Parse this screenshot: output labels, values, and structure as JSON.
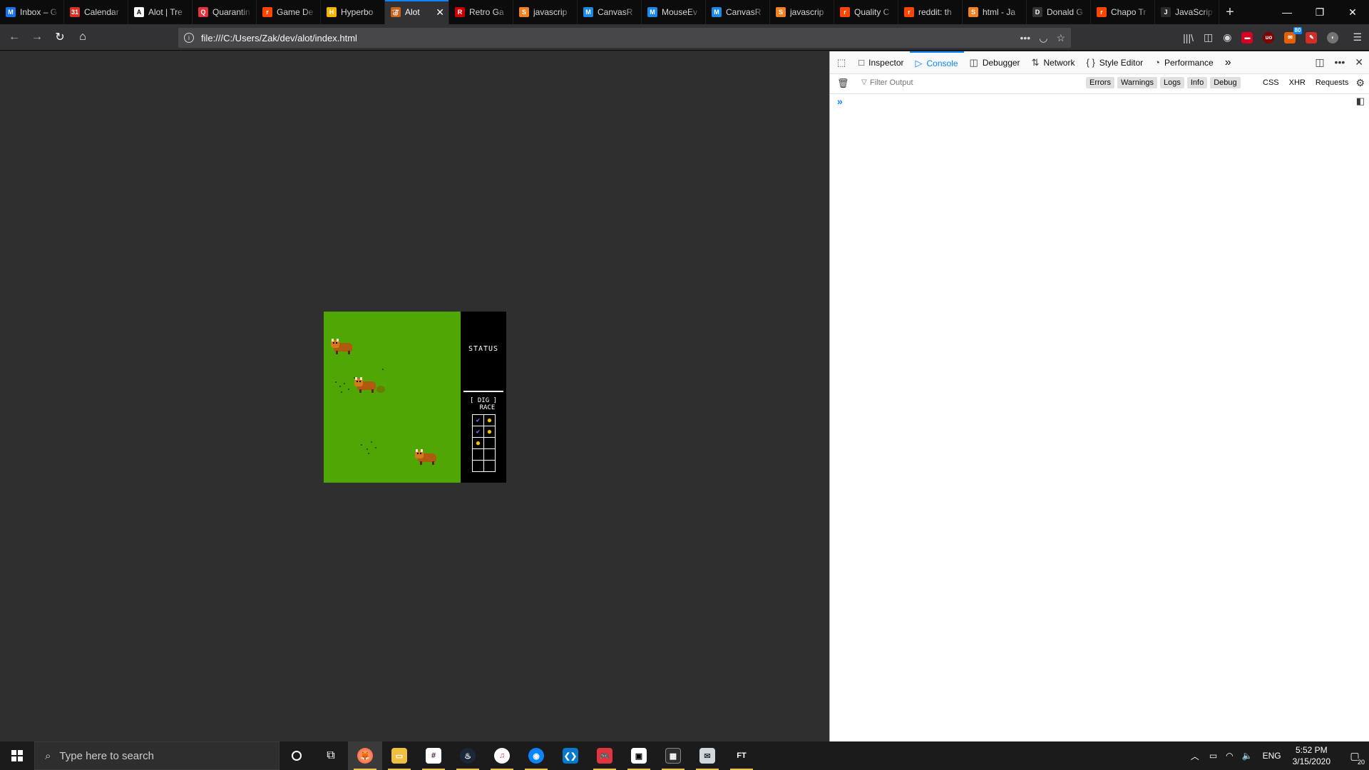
{
  "browser": {
    "tabs": [
      {
        "title": "Inbox – G",
        "fav_color": "#1a73e8",
        "fav_glyph": "M"
      },
      {
        "title": "Calendar",
        "fav_color": "#d93025",
        "fav_glyph": "31"
      },
      {
        "title": "Alot | Tre",
        "fav_color": "#ffffff",
        "fav_glyph": "A"
      },
      {
        "title": "Quarantin",
        "fav_color": "#e2343f",
        "fav_glyph": "Q"
      },
      {
        "title": "Game De",
        "fav_color": "#ff4500",
        "fav_glyph": "r"
      },
      {
        "title": "Hyperbo",
        "fav_color": "#f5b400",
        "fav_glyph": "H"
      },
      {
        "title": "Alot",
        "fav_color": "#c8641e",
        "fav_glyph": "🐮",
        "active": true
      },
      {
        "title": "Retro Ga",
        "fav_color": "#cc0000",
        "fav_glyph": "R"
      },
      {
        "title": "javascrip",
        "fav_color": "#f48024",
        "fav_glyph": "S"
      },
      {
        "title": "CanvasR",
        "fav_color": "#1e88e5",
        "fav_glyph": "M"
      },
      {
        "title": "MouseEv",
        "fav_color": "#1e88e5",
        "fav_glyph": "M"
      },
      {
        "title": "CanvasR",
        "fav_color": "#1e88e5",
        "fav_glyph": "M"
      },
      {
        "title": "javascrip",
        "fav_color": "#f48024",
        "fav_glyph": "S"
      },
      {
        "title": "Quality C",
        "fav_color": "#ff4500",
        "fav_glyph": "r"
      },
      {
        "title": "reddit: th",
        "fav_color": "#ff4500",
        "fav_glyph": "r"
      },
      {
        "title": "html - Ja",
        "fav_color": "#f48024",
        "fav_glyph": "S"
      },
      {
        "title": "Donald G",
        "fav_color": "#333333",
        "fav_glyph": "D"
      },
      {
        "title": "Chapo Tr",
        "fav_color": "#ff4500",
        "fav_glyph": "r"
      },
      {
        "title": "JavaScrip",
        "fav_color": "#2a2a2a",
        "fav_glyph": "J"
      }
    ],
    "url": "file:///C:/Users/Zak/dev/alot/index.html",
    "new_tab_glyph": "+",
    "window_controls": {
      "minimize": "—",
      "restore": "❐",
      "close": "✕"
    },
    "extension_badge": "80"
  },
  "game": {
    "status_title": "STATUS",
    "mode_label": "[ DIG ]\n  RACE",
    "inventory": [
      [
        "✔",
        "●"
      ],
      [
        "✔",
        "●"
      ],
      [
        "●",
        ""
      ],
      [
        "",
        ""
      ],
      [
        "",
        ""
      ]
    ],
    "colors": {
      "grass": "#4fa604",
      "panel": "#000000"
    }
  },
  "devtools": {
    "tabs": [
      {
        "label": "Inspector",
        "icon": "□"
      },
      {
        "label": "Console",
        "icon": "▷",
        "active": true
      },
      {
        "label": "Debugger",
        "icon": "◫"
      },
      {
        "label": "Network",
        "icon": "⇅"
      },
      {
        "label": "Style Editor",
        "icon": "{ }"
      },
      {
        "label": "Performance",
        "icon": "◔"
      }
    ],
    "more_glyph": "»",
    "filter_placeholder": "Filter Output",
    "levels": [
      "Errors",
      "Warnings",
      "Logs",
      "Info",
      "Debug"
    ],
    "requests": [
      "CSS",
      "XHR",
      "Requests"
    ],
    "prompt": "»"
  },
  "taskbar": {
    "search_placeholder": "Type here to search",
    "time": "5:52 PM",
    "date": "3/15/2020",
    "language": "ENG",
    "notifications": "20"
  }
}
